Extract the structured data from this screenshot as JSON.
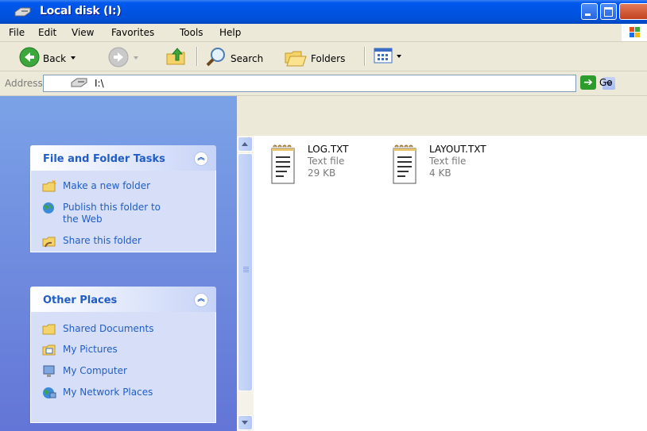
{
  "window": {
    "title": "Local disk (I:)"
  },
  "menu": [
    "File",
    "Edit",
    "View",
    "Favorites",
    "Tools",
    "Help"
  ],
  "toolbar": {
    "back_label": "Back",
    "search_label": "Search",
    "folders_label": "Folders"
  },
  "address": {
    "label": "Address",
    "path": "I:\\",
    "go_label": "Go"
  },
  "tasks_panel": {
    "title": "File and Folder Tasks",
    "items": [
      {
        "label": "Make a new folder",
        "icon": "new-folder-icon"
      },
      {
        "label": "Publish this folder to the Web",
        "icon": "publish-web-icon"
      },
      {
        "label": "Share this folder",
        "icon": "share-folder-icon"
      }
    ]
  },
  "places_panel": {
    "title": "Other Places",
    "items": [
      {
        "label": "Shared Documents",
        "icon": "folder-icon"
      },
      {
        "label": "My Pictures",
        "icon": "my-pictures-icon"
      },
      {
        "label": "My Computer",
        "icon": "my-computer-icon"
      },
      {
        "label": "My Network Places",
        "icon": "network-places-icon"
      }
    ]
  },
  "files": [
    {
      "name": "LOG.TXT",
      "type": "Text file",
      "size": "29 KB"
    },
    {
      "name": "LAYOUT.TXT",
      "type": "Text file",
      "size": "4 KB"
    }
  ],
  "colors": {
    "titlebar": "#0054E3",
    "task_link": "#215DC6",
    "pane_bg": "#7BA2E7"
  }
}
